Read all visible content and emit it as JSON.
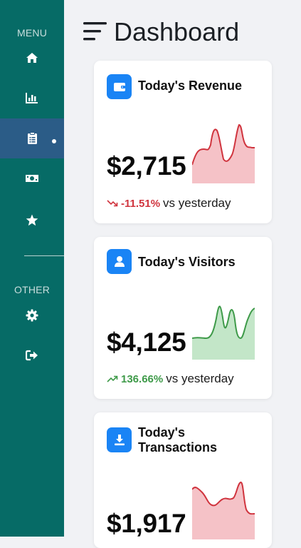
{
  "sidebar": {
    "menu_heading": "MENU",
    "other_heading": "OTHER",
    "items": [
      {
        "icon": "home-icon"
      },
      {
        "icon": "bar-chart-icon"
      },
      {
        "icon": "clipboard-icon",
        "active": true
      },
      {
        "icon": "money-icon"
      },
      {
        "icon": "star-icon"
      },
      {
        "icon": "gear-icon"
      },
      {
        "icon": "sign-out-icon"
      }
    ]
  },
  "header": {
    "title": "Dashboard",
    "menu_icon": "hamburger-menu-icon"
  },
  "cards": [
    {
      "title": "Today's Revenue",
      "icon": "wallet-icon",
      "value": "$2,715",
      "change": "-11.51%",
      "change_direction": "down",
      "suffix": "vs yesterday",
      "color": "#d0343e",
      "fill": "#f5c2c7"
    },
    {
      "title": "Today's Visitors",
      "icon": "user-icon",
      "value": "$4,125",
      "change": "136.66%",
      "change_direction": "up",
      "suffix": "vs yesterday",
      "color": "#3e9a49",
      "fill": "#c3e6c8"
    },
    {
      "title_line1": "Today's",
      "title_line2": "Transactions",
      "icon": "download-icon",
      "value": "$1,917",
      "color": "#d0343e",
      "fill": "#f5c2c7"
    }
  ],
  "colors": {
    "sidebar": "#066b66",
    "active_item": "#2b5c87",
    "accent": "#1a84f5",
    "background": "#f1f2f5"
  }
}
